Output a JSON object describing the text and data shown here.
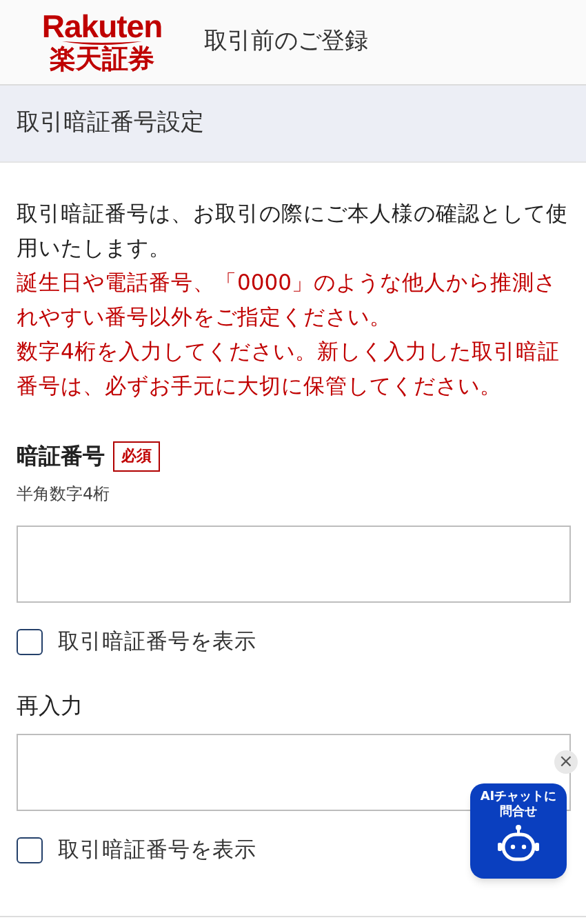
{
  "header": {
    "logo_latin": "Rakuten",
    "logo_japanese": "楽天証券",
    "title": "取引前のご登録"
  },
  "section": {
    "title": "取引暗証番号設定"
  },
  "notes": [
    {
      "kind": "normal",
      "text": "取引暗証番号は、お取引の際にご本人様の確認として使用いたします。"
    },
    {
      "kind": "warning",
      "text": "誕生日や電話番号、「0000」のような他人から推測されやすい番号以外をご指定ください。"
    },
    {
      "kind": "warning",
      "text": "数字4桁を入力してください。新しく入力した取引暗証番号は、必ずお手元に大切に保管してください。"
    }
  ],
  "fields": [
    {
      "label": "暗証番号",
      "required_badge": "必須",
      "hint": "半角数字4桁",
      "show_checkbox": {
        "label": "取引暗証番号を表示",
        "checked": false
      }
    },
    {
      "label": "再入力",
      "show_checkbox": {
        "label": "取引暗証番号を表示",
        "checked": false
      }
    }
  ],
  "chat_widget": {
    "label_lines": [
      "AIチャットに",
      "問合せ"
    ],
    "close": "×"
  }
}
